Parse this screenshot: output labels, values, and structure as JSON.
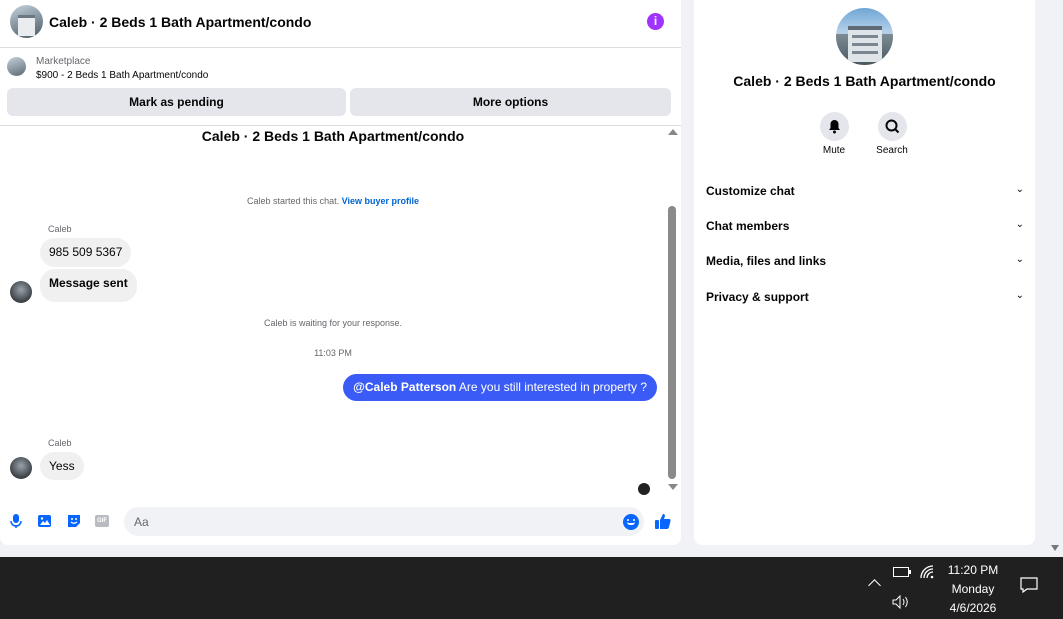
{
  "chat": {
    "header_title": "Caleb · 2 Beds 1 Bath Apartment/condo",
    "info_icon": "info-icon",
    "listing": {
      "kicker": "Marketplace",
      "summary": "$900 - 2 Beds 1 Bath Apartment/condo"
    },
    "buttons": {
      "mark_pending": "Mark as pending",
      "more_options": "More options"
    },
    "thread_title": "Caleb · 2 Beds 1 Bath Apartment/condo",
    "started_text": "Caleb started this chat.",
    "view_profile": "View buyer profile",
    "messages": [
      {
        "sender": "Caleb",
        "lines": [
          "985 509 5367",
          "Message sent"
        ]
      },
      {
        "sender": "Caleb",
        "lines": [
          "Yess"
        ]
      }
    ],
    "waiting_text": "Caleb is waiting for your response.",
    "timestamp": "11:03 PM",
    "outgoing": {
      "mention": "@Caleb Patterson",
      "text": " Are you still interested in property ?"
    },
    "composer": {
      "placeholder": "Aa",
      "gif_label": "GIF"
    }
  },
  "info_panel": {
    "name": "Caleb · 2 Beds 1 Bath Apartment/condo",
    "actions": [
      {
        "label": "Mute",
        "icon": "bell-icon"
      },
      {
        "label": "Search",
        "icon": "search-icon"
      }
    ],
    "sections": [
      "Customize chat",
      "Chat members",
      "Media, files and links",
      "Privacy & support"
    ]
  },
  "taskbar": {
    "time": "11:20 PM",
    "day": "Monday",
    "date": "4/6/2026"
  },
  "colors": {
    "accent": "#0866ff",
    "outgoing_bubble": "#3a5bf5",
    "info_icon": "#a033ff",
    "taskbar": "#202020"
  }
}
